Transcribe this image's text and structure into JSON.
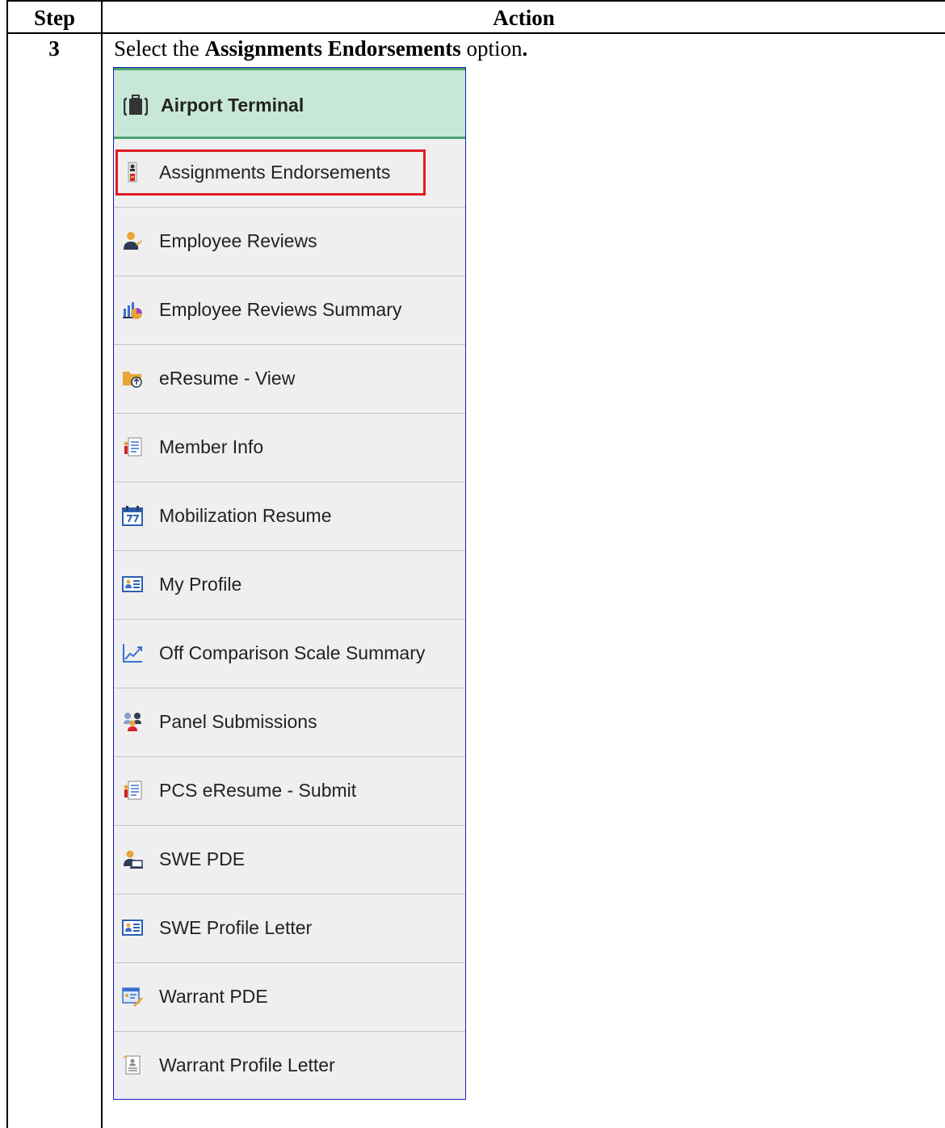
{
  "table": {
    "header_step": "Step",
    "header_action": "Action",
    "step_number": "3",
    "instruction_prefix": "Select the ",
    "instruction_bold": "Assignments Endorsements",
    "instruction_suffix": " option",
    "instruction_period": "."
  },
  "panel": {
    "title": "Airport Terminal",
    "title_icon": "briefcase-icon",
    "highlight_color": "#e01b24",
    "items": [
      {
        "label": "Assignments Endorsements",
        "icon": "endorsement-icon"
      },
      {
        "label": "Employee Reviews",
        "icon": "employee-review-icon"
      },
      {
        "label": "Employee Reviews Summary",
        "icon": "bar-chart-icon"
      },
      {
        "label": "eResume - View",
        "icon": "folder-icon"
      },
      {
        "label": "Member Info",
        "icon": "member-info-icon"
      },
      {
        "label": "Mobilization Resume",
        "icon": "calendar-icon"
      },
      {
        "label": "My Profile",
        "icon": "profile-card-icon"
      },
      {
        "label": "Off Comparison Scale Summary",
        "icon": "line-chart-icon"
      },
      {
        "label": "Panel Submissions",
        "icon": "people-icon"
      },
      {
        "label": "PCS eResume - Submit",
        "icon": "member-info-icon"
      },
      {
        "label": "SWE PDE",
        "icon": "user-computer-icon"
      },
      {
        "label": "SWE Profile Letter",
        "icon": "profile-card-icon"
      },
      {
        "label": "Warrant PDE",
        "icon": "edit-form-icon"
      },
      {
        "label": "Warrant Profile Letter",
        "icon": "document-icon"
      }
    ]
  }
}
